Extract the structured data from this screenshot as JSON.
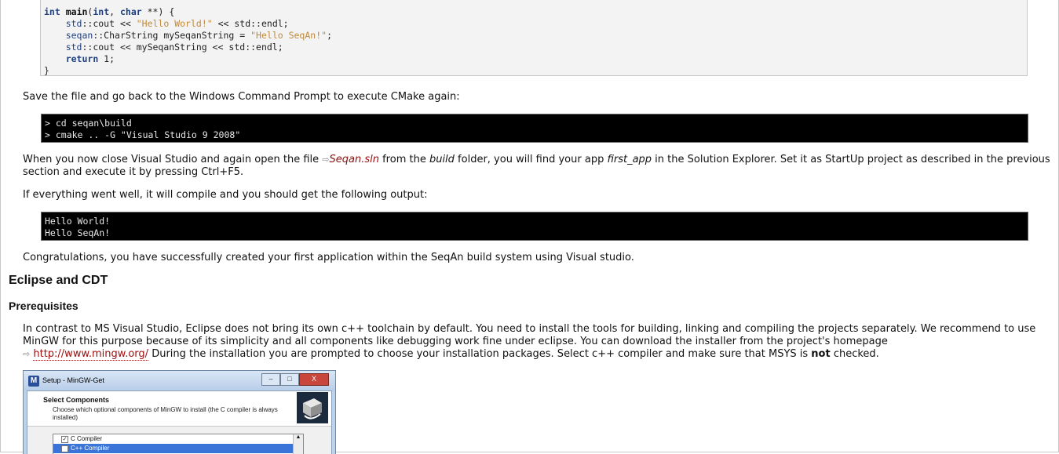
{
  "code": {
    "line1": {
      "kw1": "int",
      "fn": "main",
      "p1": "(",
      "kw2": "int",
      "p2": ", ",
      "kw3": "char",
      "p3": " **) {"
    },
    "line2": {
      "ns": "std",
      "rest": "::cout << ",
      "str": "\"Hello World!\"",
      "rest2": " << std::endl;"
    },
    "line3": {
      "ns": "seqan",
      "rest": "::CharString mySeqanString = ",
      "str": "\"Hello SeqAn!\"",
      "rest2": ";"
    },
    "line4": {
      "ns": "std",
      "rest": "::cout << mySeqanString << std::endl;"
    },
    "line5": {
      "kw": "return",
      "rest": " 1;"
    },
    "line6": "}"
  },
  "para_save": "Save the file and go back to the Windows Command Prompt to execute CMake again:",
  "term_cmake": {
    "line1": "> cd seqan\\build",
    "line2": "> cmake .. -G \"Visual Studio 9 2008\""
  },
  "para_when": {
    "t1": "When you now close Visual Studio and again open the file ",
    "file_link": "Seqan",
    "file_ext": ".sln",
    "t2": " from the ",
    "build": "build",
    "t3": " folder, you will find your app ",
    "app": "first_app",
    "t4": " in the Solution Explorer. Set it as StartUp project as described in the previous section and execute it by pressing Ctrl+F5."
  },
  "para_if": "If everything went well, it will compile and you should get the following output:",
  "term_output": {
    "line1": "Hello World!",
    "line2": "Hello SeqAn!"
  },
  "para_congrats": "Congratulations, you have successfully created your first application within the SeqAn build system using Visual studio.",
  "heading_eclipse": "Eclipse and CDT",
  "heading_prereq": "Prerequisites",
  "para_contrast": {
    "t1": "In contrast to MS Visual Studio, Eclipse does not bring its own c++ toolchain by default. You need to install the tools for building, linking and compiling the projects separately. We recommend to use MinGW for this purpose because of its simplicity and all components like debugging work fine under eclipse. You can download the installer from the project's homepage ",
    "link": "http://www.mingw.org/",
    "t2": " During the installation you are prompted to choose your installation packages. Select c++ compiler and make sure that MSYS is ",
    "not": "not",
    "t3": " checked."
  },
  "dialog": {
    "logo": "M",
    "title": "Setup - MinGW-Get",
    "min": "–",
    "max": "□",
    "close": "X",
    "header": "Select Components",
    "sub": "Choose which optional components of MinGW to install (the C compiler is always installed)",
    "items": [
      {
        "label": "C Compiler",
        "check": "✓"
      },
      {
        "label": "C++ Compiler",
        "check": "✓"
      }
    ],
    "scroll_up": "▲"
  }
}
